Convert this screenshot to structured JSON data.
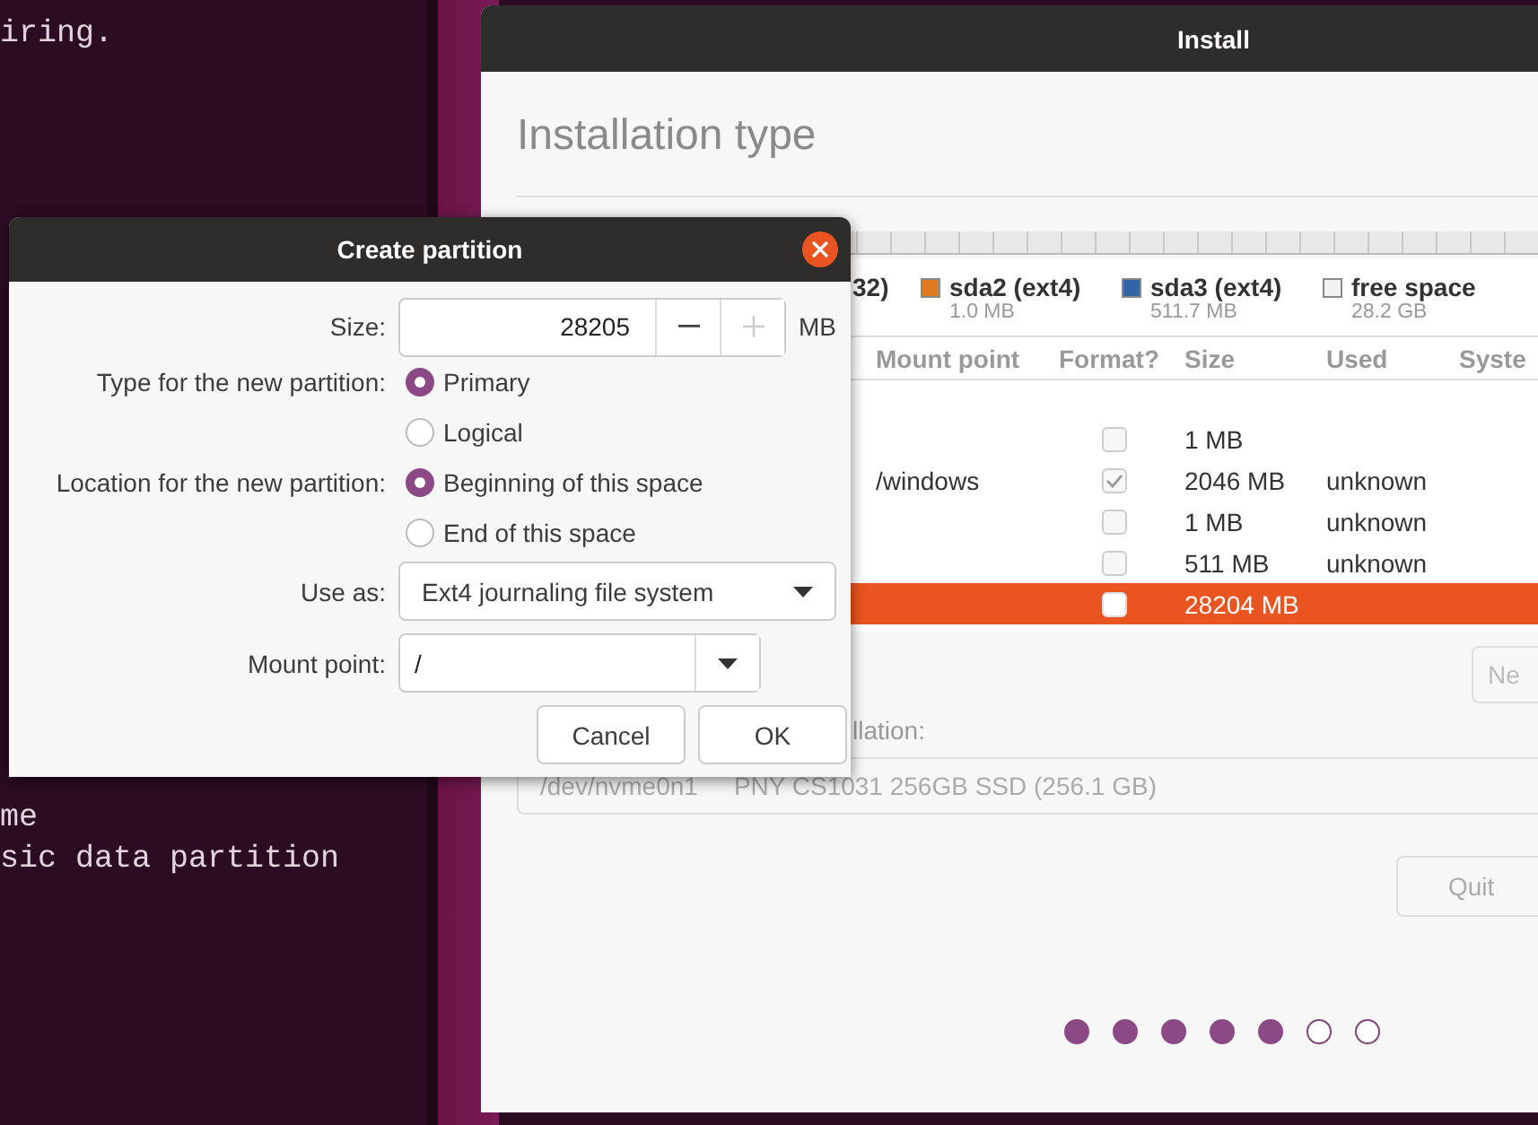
{
  "terminal": {
    "lines": [
      "iring.",
      "me",
      "sic data partition"
    ]
  },
  "install_window": {
    "title": "Install",
    "heading": "Installation type",
    "legend": [
      {
        "label": "32)"
      },
      {
        "label": "sda2 (ext4)",
        "size": "1.0 MB",
        "color": "#e07a1f"
      },
      {
        "label": "sda3 (ext4)",
        "size": "511.7 MB",
        "color": "#3465a4"
      },
      {
        "label": "free space",
        "size": "28.2 GB",
        "color": "#f2f2f2"
      }
    ],
    "table": {
      "columns": [
        "Mount point",
        "Format?",
        "Size",
        "Used",
        "Syste"
      ],
      "rows": [
        {
          "format_checked": false,
          "size": "1 MB",
          "selected": false
        },
        {
          "mount_point": "/windows",
          "format_checked": true,
          "size": "2046 MB",
          "used": "unknown",
          "selected": false
        },
        {
          "format_checked": false,
          "size": "1 MB",
          "used": "unknown",
          "selected": false
        },
        {
          "format_checked": false,
          "size": "511 MB",
          "used": "unknown",
          "selected": false
        },
        {
          "format_checked": false,
          "size": "28204 MB",
          "selected": true
        }
      ]
    },
    "new_button": "Ne",
    "boot_loader_label": "llation:",
    "boot_device": {
      "device": "/dev/nvme0n1",
      "description": "PNY CS1031 256GB SSD (256.1 GB)"
    },
    "quit_button": "Quit",
    "steps": [
      {
        "done": true
      },
      {
        "done": true
      },
      {
        "done": true
      },
      {
        "done": true
      },
      {
        "done": true
      },
      {
        "done": false
      },
      {
        "done": false
      }
    ]
  },
  "dialog": {
    "title": "Create partition",
    "size": {
      "label": "Size:",
      "value": "28205",
      "unit": "MB"
    },
    "type": {
      "label": "Type for the new partition:",
      "options": [
        {
          "label": "Primary",
          "selected": true
        },
        {
          "label": "Logical",
          "selected": false
        }
      ]
    },
    "location": {
      "label": "Location for the new partition:",
      "options": [
        {
          "label": "Beginning of this space",
          "selected": true
        },
        {
          "label": "End of this space",
          "selected": false
        }
      ]
    },
    "use_as": {
      "label": "Use as:",
      "value": "Ext4 journaling file system"
    },
    "mount_point": {
      "label": "Mount point:",
      "value": "/"
    },
    "buttons": [
      "Cancel",
      "OK"
    ]
  }
}
